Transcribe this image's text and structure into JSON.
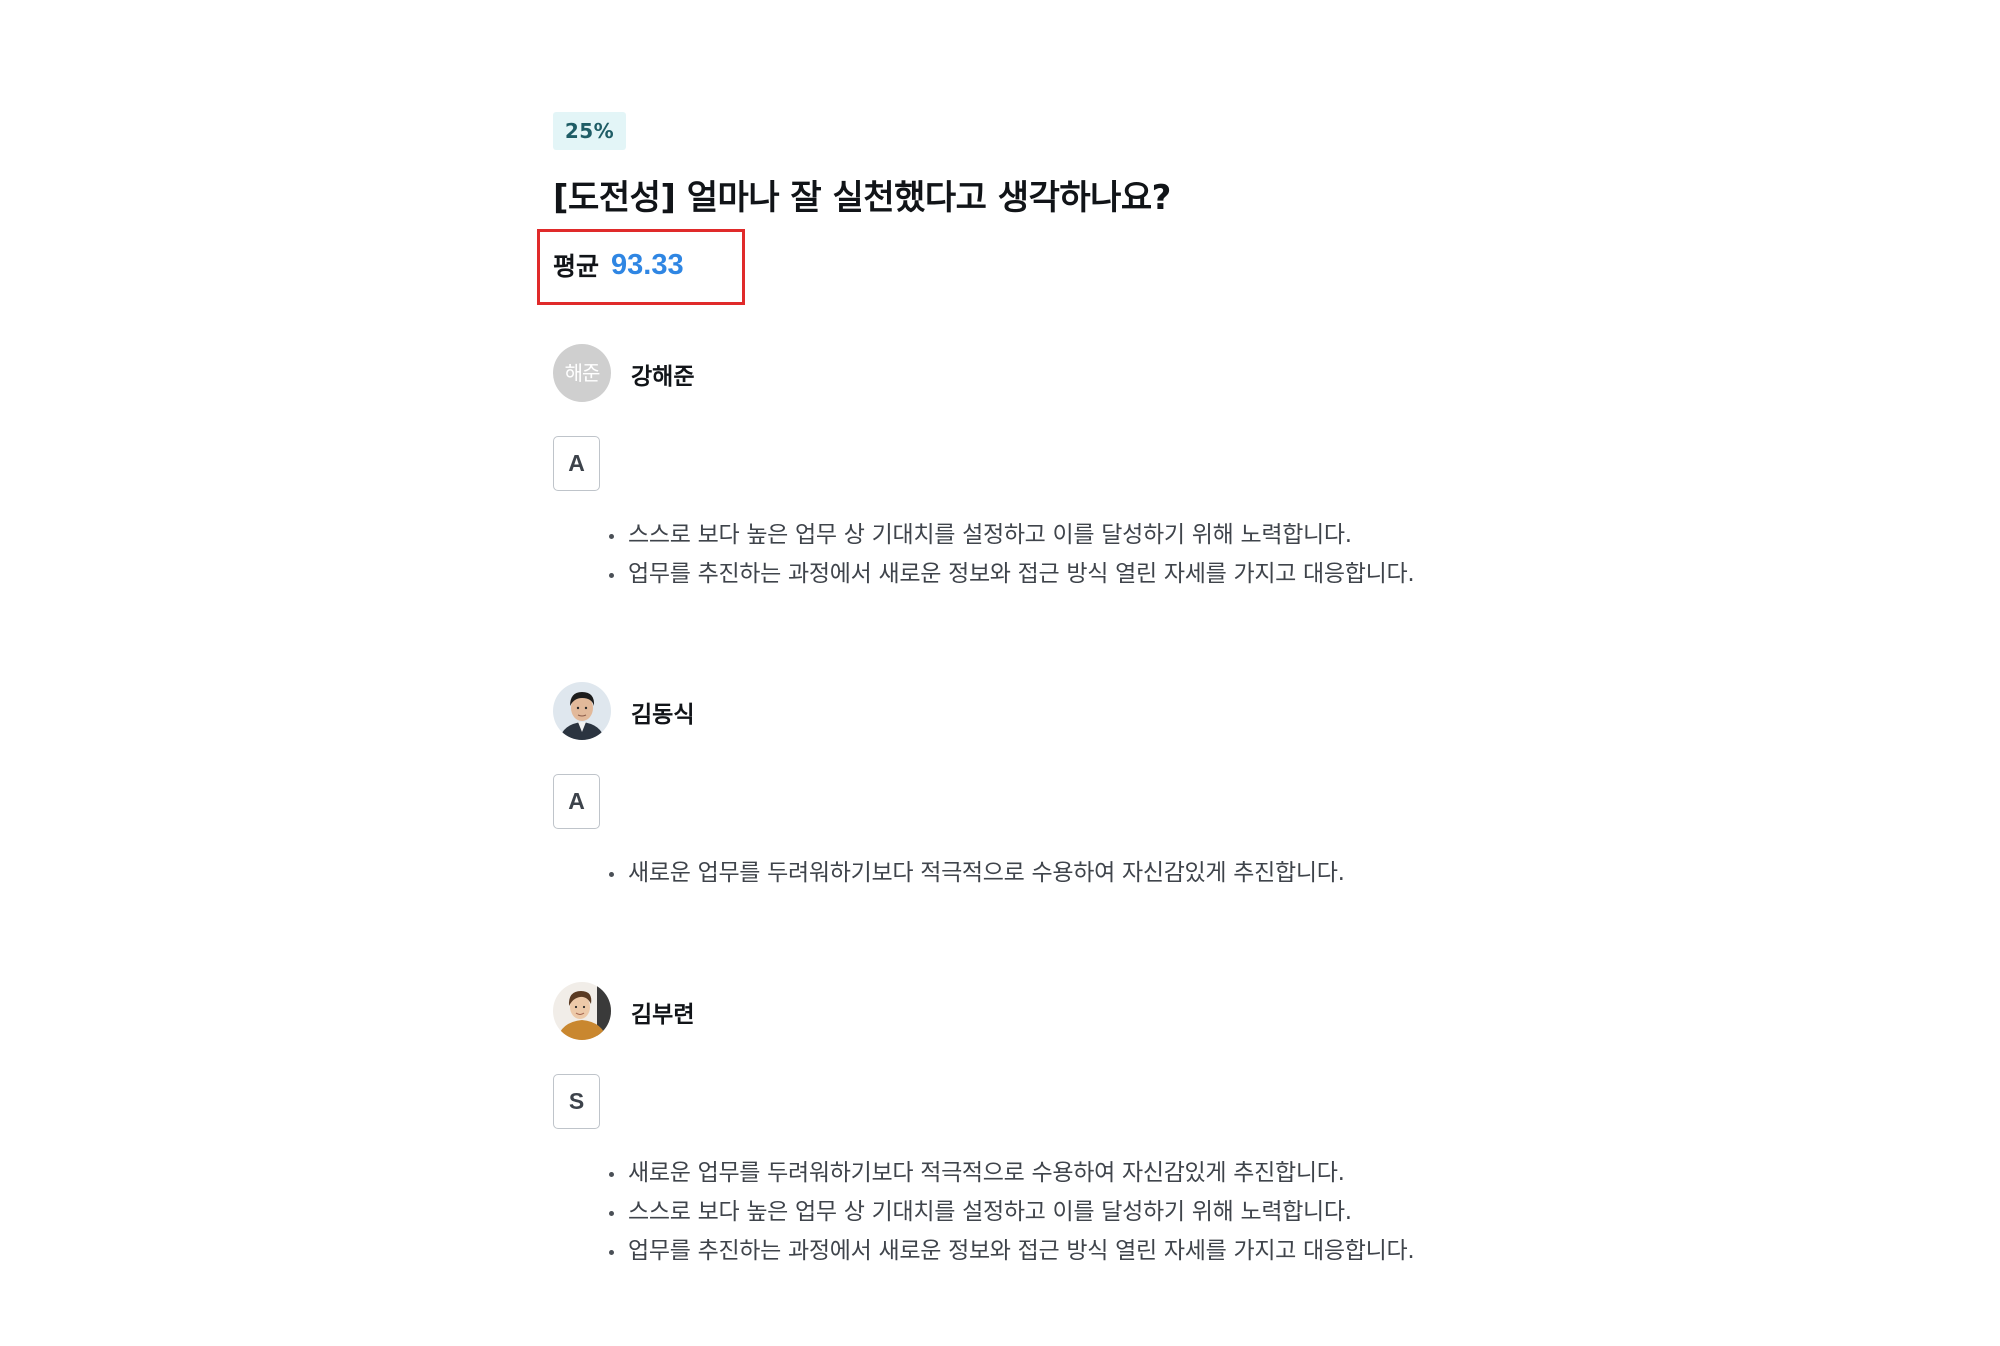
{
  "progress": {
    "label": "25%",
    "value_percent": 25
  },
  "question": {
    "title": "[도전성] 얼마나 잘 실천했다고 생각하나요?"
  },
  "average": {
    "label": "평균",
    "value": "93.33"
  },
  "responses": [
    {
      "name": "강해준",
      "avatar": {
        "type": "initials",
        "initials": "해준",
        "icon": "initials-avatar"
      },
      "grade": "A",
      "behaviors": [
        "스스로 보다 높은 업무 상 기대치를 설정하고 이를 달성하기 위해 노력합니다.",
        "업무를 추진하는 과정에서 새로운 정보와 접근 방식 열린 자세를 가지고 대응합니다."
      ]
    },
    {
      "name": "김동식",
      "avatar": {
        "type": "photo",
        "icon": "user-photo-avatar"
      },
      "grade": "A",
      "behaviors": [
        "새로운 업무를 두려워하기보다 적극적으로 수용하여 자신감있게 추진합니다."
      ]
    },
    {
      "name": "김부련",
      "avatar": {
        "type": "photo",
        "icon": "user-photo-avatar"
      },
      "grade": "S",
      "behaviors": [
        "새로운 업무를 두려워하기보다 적극적으로 수용하여 자신감있게 추진합니다.",
        "스스로 보다 높은 업무 상 기대치를 설정하고 이를 달성하기 위해 노력합니다.",
        "업무를 추진하는 과정에서 새로운 정보와 접근 방식 열린 자세를 가지고 대응합니다."
      ]
    }
  ],
  "colors": {
    "accent_blue": "#2f86e3",
    "badge_bg": "#e3f5f7",
    "highlight_box": "#e02a2a"
  }
}
